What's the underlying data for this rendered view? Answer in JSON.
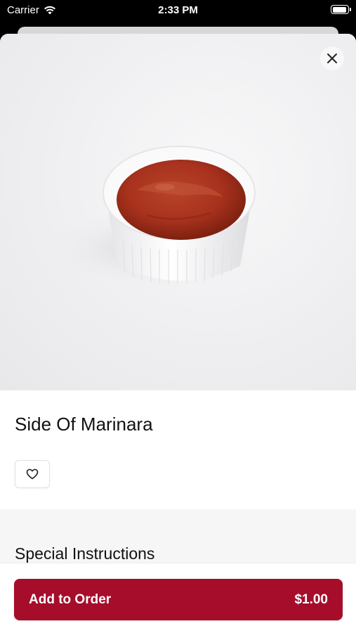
{
  "status_bar": {
    "carrier": "Carrier",
    "time": "2:33 PM"
  },
  "item": {
    "name": "Side Of Marinara"
  },
  "special_instructions": {
    "title": "Special Instructions"
  },
  "add_to_order": {
    "label": "Add to Order",
    "price": "$1.00"
  },
  "icons": {
    "close": "close-icon",
    "favorite": "heart-icon",
    "wifi": "wifi-icon",
    "battery": "battery-icon"
  },
  "colors": {
    "brand": "#a60d2b",
    "sauce": "#a8321d",
    "background": "#eeeef0"
  }
}
